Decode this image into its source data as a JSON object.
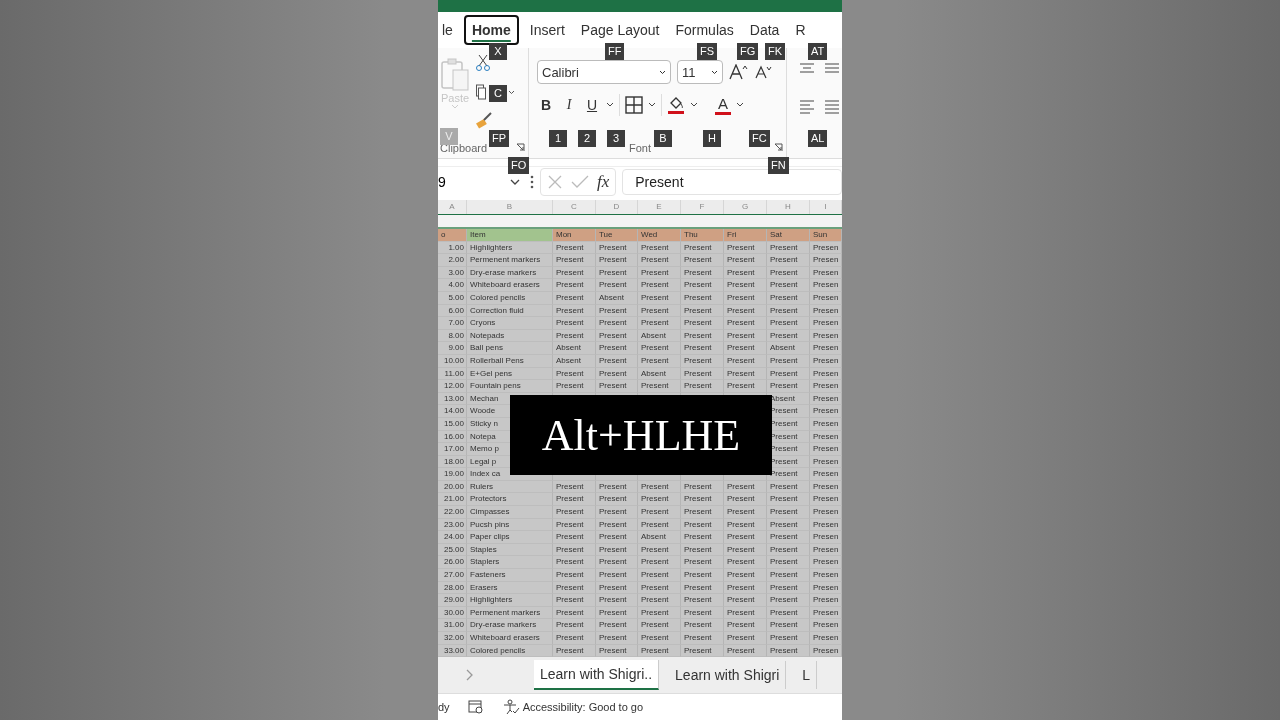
{
  "tabs": [
    {
      "label": "le",
      "selected": false
    },
    {
      "label": "Home",
      "selected": true
    },
    {
      "label": "Insert",
      "selected": false
    },
    {
      "label": "Page Layout",
      "selected": false
    },
    {
      "label": "Formulas",
      "selected": false
    },
    {
      "label": "Data",
      "selected": false
    },
    {
      "label": "R",
      "selected": false
    }
  ],
  "key_tips": [
    {
      "label": "X",
      "disabled": false
    },
    {
      "label": "FF",
      "disabled": false
    },
    {
      "label": "FS",
      "disabled": false
    },
    {
      "label": "FG",
      "disabled": false
    },
    {
      "label": "FK",
      "disabled": false
    },
    {
      "label": "AT",
      "disabled": false
    },
    {
      "label": "C",
      "disabled": false
    },
    {
      "label": "V",
      "disabled": true
    },
    {
      "label": "FP",
      "disabled": false
    },
    {
      "label": "1",
      "disabled": false
    },
    {
      "label": "2",
      "disabled": false
    },
    {
      "label": "3",
      "disabled": false
    },
    {
      "label": "B",
      "disabled": false
    },
    {
      "label": "H",
      "disabled": false
    },
    {
      "label": "FC",
      "disabled": false
    },
    {
      "label": "AL",
      "disabled": false
    },
    {
      "label": "FO",
      "disabled": false
    },
    {
      "label": "FN",
      "disabled": false
    }
  ],
  "ribbon": {
    "paste": {
      "label": "Paste",
      "disabled": true
    },
    "font_name": "Calibri",
    "font_size": "11",
    "bold": "B",
    "italic": "I",
    "underline": "U",
    "font_color": "A",
    "groups": [
      "Clipboard",
      "Font"
    ]
  },
  "formula_bar": {
    "name_box": "9",
    "fx": "fx",
    "value": "Present"
  },
  "sheet": {
    "column_letters": [
      "A",
      "B",
      "C",
      "D",
      "E",
      "F",
      "G",
      "H",
      "I"
    ],
    "header": [
      "o",
      "Item",
      "Mon",
      "Tue",
      "Wed",
      "Thu",
      "Fri",
      "Sat",
      "Sun"
    ],
    "rows": [
      {
        "no": "1.00",
        "item": "Highlighters",
        "days": [
          "Present",
          "Present",
          "Present",
          "Present",
          "Present",
          "Present",
          "Presen"
        ]
      },
      {
        "no": "2.00",
        "item": "Permenent markers",
        "days": [
          "Present",
          "Present",
          "Present",
          "Present",
          "Present",
          "Present",
          "Presen"
        ]
      },
      {
        "no": "3.00",
        "item": "Dry-erase markers",
        "days": [
          "Present",
          "Present",
          "Present",
          "Present",
          "Present",
          "Present",
          "Presen"
        ]
      },
      {
        "no": "4.00",
        "item": "Whiteboard erasers",
        "days": [
          "Present",
          "Present",
          "Present",
          "Present",
          "Present",
          "Present",
          "Presen"
        ]
      },
      {
        "no": "5.00",
        "item": "Colored pencils",
        "days": [
          "Present",
          "Absent",
          "Present",
          "Present",
          "Present",
          "Present",
          "Presen"
        ]
      },
      {
        "no": "6.00",
        "item": "Correction fluid",
        "days": [
          "Present",
          "Present",
          "Present",
          "Present",
          "Present",
          "Present",
          "Presen"
        ]
      },
      {
        "no": "7.00",
        "item": "Cryons",
        "days": [
          "Present",
          "Present",
          "Present",
          "Present",
          "Present",
          "Present",
          "Presen"
        ]
      },
      {
        "no": "8.00",
        "item": "Notepads",
        "days": [
          "Present",
          "Present",
          "Absent",
          "Present",
          "Present",
          "Present",
          "Presen"
        ]
      },
      {
        "no": "9.00",
        "item": "Ball pens",
        "days": [
          "Absent",
          "Present",
          "Present",
          "Present",
          "Present",
          "Absent",
          "Presen"
        ]
      },
      {
        "no": "10.00",
        "item": "Rollerball Pens",
        "days": [
          "Absent",
          "Present",
          "Present",
          "Present",
          "Present",
          "Present",
          "Presen"
        ]
      },
      {
        "no": "11.00",
        "item": "E+Gel pens",
        "days": [
          "Present",
          "Present",
          "Absent",
          "Present",
          "Present",
          "Present",
          "Presen"
        ]
      },
      {
        "no": "12.00",
        "item": "Fountain pens",
        "days": [
          "Present",
          "Present",
          "Present",
          "Present",
          "Present",
          "Present",
          "Presen"
        ]
      },
      {
        "no": "13.00",
        "item": "Mechan",
        "days": [
          "Absent",
          "Presen"
        ]
      },
      {
        "no": "14.00",
        "item": "Woode",
        "days": [
          "Present",
          "Presen"
        ]
      },
      {
        "no": "15.00",
        "item": "Sticky n",
        "days": [
          "Present",
          "Presen"
        ]
      },
      {
        "no": "16.00",
        "item": "Notepa",
        "days": [
          "Present",
          "Presen"
        ]
      },
      {
        "no": "17.00",
        "item": "Memo p",
        "days": [
          "Present",
          "Presen"
        ]
      },
      {
        "no": "18.00",
        "item": "Legal p",
        "days": [
          "Present",
          "Presen"
        ]
      },
      {
        "no": "19.00",
        "item": "Index ca",
        "days": [
          "Present",
          "Presen"
        ]
      },
      {
        "no": "20.00",
        "item": "Rulers",
        "days": [
          "Present",
          "Present",
          "Present",
          "Present",
          "Present",
          "Present",
          "Presen"
        ]
      },
      {
        "no": "21.00",
        "item": "Protectors",
        "days": [
          "Present",
          "Present",
          "Present",
          "Present",
          "Present",
          "Present",
          "Presen"
        ]
      },
      {
        "no": "22.00",
        "item": "Cimpasses",
        "days": [
          "Present",
          "Present",
          "Present",
          "Present",
          "Present",
          "Present",
          "Presen"
        ]
      },
      {
        "no": "23.00",
        "item": "Pucsh pins",
        "days": [
          "Present",
          "Present",
          "Present",
          "Present",
          "Present",
          "Present",
          "Presen"
        ]
      },
      {
        "no": "24.00",
        "item": "Paper clips",
        "days": [
          "Present",
          "Present",
          "Absent",
          "Present",
          "Present",
          "Present",
          "Presen"
        ]
      },
      {
        "no": "25.00",
        "item": "Staples",
        "days": [
          "Present",
          "Present",
          "Present",
          "Present",
          "Present",
          "Present",
          "Presen"
        ]
      },
      {
        "no": "26.00",
        "item": "Staplers",
        "days": [
          "Present",
          "Present",
          "Present",
          "Present",
          "Present",
          "Present",
          "Presen"
        ]
      },
      {
        "no": "27.00",
        "item": "Fasteners",
        "days": [
          "Present",
          "Present",
          "Present",
          "Present",
          "Present",
          "Present",
          "Presen"
        ]
      },
      {
        "no": "28.00",
        "item": "Erasers",
        "days": [
          "Present",
          "Present",
          "Present",
          "Present",
          "Present",
          "Present",
          "Presen"
        ]
      },
      {
        "no": "29.00",
        "item": "Highlighters",
        "days": [
          "Present",
          "Present",
          "Present",
          "Present",
          "Present",
          "Present",
          "Presen"
        ]
      },
      {
        "no": "30.00",
        "item": "Permenent markers",
        "days": [
          "Present",
          "Present",
          "Present",
          "Present",
          "Present",
          "Present",
          "Presen"
        ]
      },
      {
        "no": "31.00",
        "item": "Dry-erase markers",
        "days": [
          "Present",
          "Present",
          "Present",
          "Present",
          "Present",
          "Present",
          "Presen"
        ]
      },
      {
        "no": "32.00",
        "item": "Whiteboard erasers",
        "days": [
          "Present",
          "Present",
          "Present",
          "Present",
          "Present",
          "Present",
          "Presen"
        ]
      },
      {
        "no": "33.00",
        "item": "Colored pencils",
        "days": [
          "Present",
          "Present",
          "Present",
          "Present",
          "Present",
          "Present",
          "Presen"
        ]
      }
    ]
  },
  "caption": "Alt+HLHE",
  "sheet_tabs": [
    {
      "label": "Learn with Shigri..",
      "selected": true
    },
    {
      "label": "Learn with Shigri",
      "selected": false
    },
    {
      "label": "L",
      "selected": false
    }
  ],
  "status_bar": {
    "mode": "dy",
    "accessibility": "Accessibility: Good to go"
  }
}
